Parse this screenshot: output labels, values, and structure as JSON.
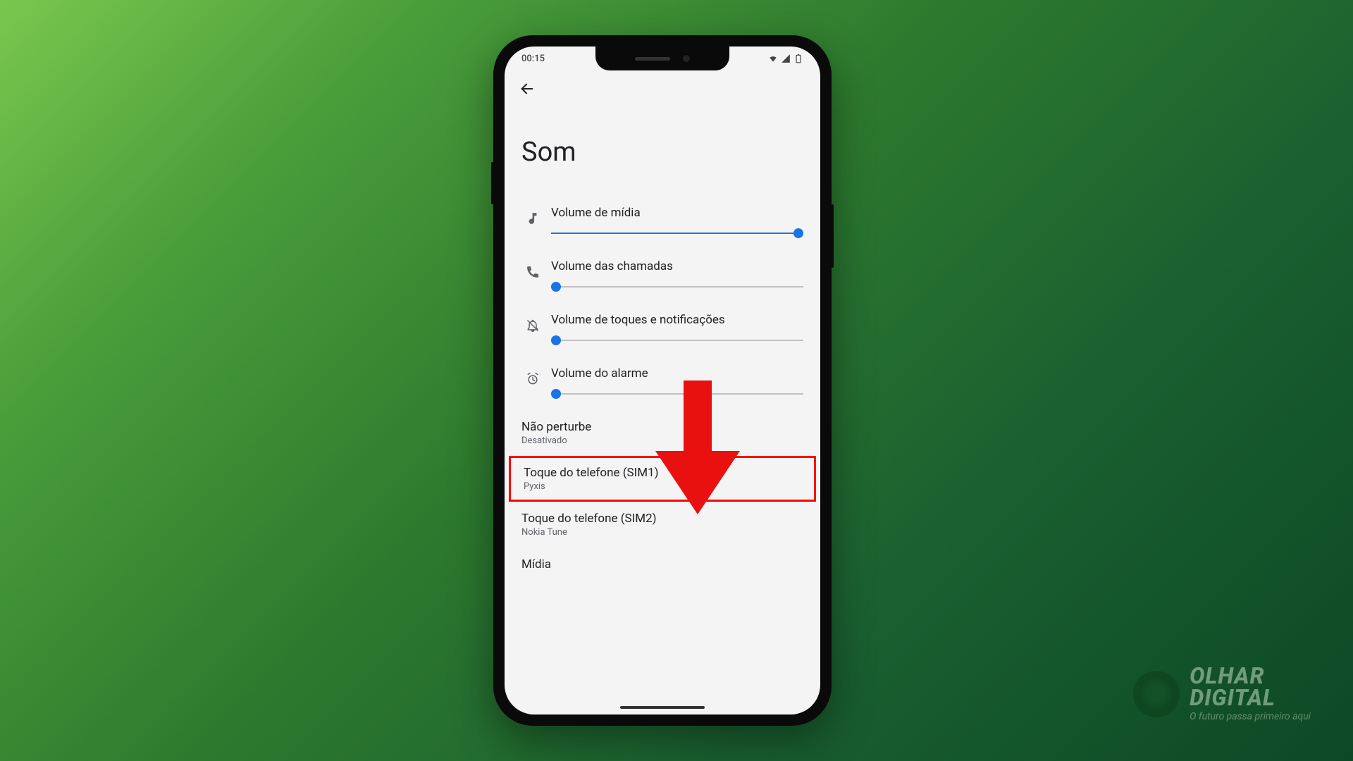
{
  "status": {
    "time": "00:15"
  },
  "page": {
    "title": "Som"
  },
  "sliders": {
    "media": {
      "label": "Volume de mídia",
      "pct": 98
    },
    "call": {
      "label": "Volume das chamadas",
      "pct": 2
    },
    "ring": {
      "label": "Volume de toques e notificações",
      "pct": 2
    },
    "alarm": {
      "label": "Volume do alarme",
      "pct": 2
    }
  },
  "items": {
    "dnd": {
      "title": "Não perturbe",
      "sub": "Desativado"
    },
    "sim1": {
      "title": "Toque do telefone (SIM1)",
      "sub": "Pyxis"
    },
    "sim2": {
      "title": "Toque do telefone (SIM2)",
      "sub": "Nokia Tune"
    },
    "media": {
      "title": "Mídia"
    }
  },
  "branding": {
    "line1": "OLHAR",
    "line2": "DIGITAL",
    "tagline": "O futuro passa primeiro aqui"
  }
}
